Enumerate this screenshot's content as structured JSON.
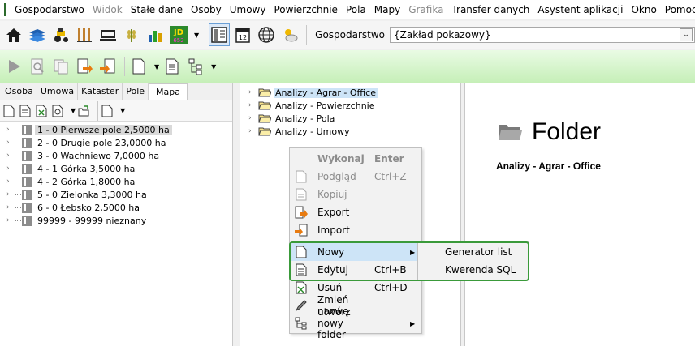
{
  "menubar": {
    "items": [
      {
        "label": "Gospodarstwo",
        "disabled": false
      },
      {
        "label": "Widok",
        "disabled": true
      },
      {
        "label": "Stałe dane",
        "disabled": false
      },
      {
        "label": "Osoby",
        "disabled": false
      },
      {
        "label": "Umowy",
        "disabled": false
      },
      {
        "label": "Powierzchnie",
        "disabled": false
      },
      {
        "label": "Pola",
        "disabled": false
      },
      {
        "label": "Mapy",
        "disabled": false
      },
      {
        "label": "Grafika",
        "disabled": true
      },
      {
        "label": "Transfer danych",
        "disabled": false
      },
      {
        "label": "Asystent aplikacji",
        "disabled": false
      },
      {
        "label": "Okno",
        "disabled": false
      },
      {
        "label": "Pomoc",
        "disabled": false
      }
    ]
  },
  "toolbar": {
    "gospodarstwo_label": "Gospodarstwo",
    "gospodarstwo_value": "{Zakład pokazowy}",
    "jd_text": "JD",
    "jd_sub": "652",
    "calendar_text": "12"
  },
  "left_panel": {
    "tabs": [
      "Osoba",
      "Umowa",
      "Kataster",
      "Pole",
      "Mapa"
    ],
    "active_tab": "Mapa",
    "fields": [
      "1 - 0 Pierwsze pole 2,5000 ha",
      "2 - 0 Drugie pole 23,0000 ha",
      "3 - 0 Wachniewo 7,0000 ha",
      "4 - 1 Górka 3,5000 ha",
      "4 - 2 Górka 1,8000 ha",
      "5 - 0 Zielonka 3,3000 ha",
      "6 - 0 Łebsko 2,5000 ha",
      "99999 - 99999 nieznany"
    ]
  },
  "tree": {
    "items": [
      "Analizy - Agrar - Office",
      "Analizy - Powierzchnie",
      "Analizy - Pola",
      "Analizy - Umowy"
    ]
  },
  "right_panel": {
    "title": "Folder",
    "subtitle": "Analizy - Agrar - Office"
  },
  "context_menu": {
    "items": [
      {
        "label": "Wykonaj",
        "shortcut": "Enter"
      },
      {
        "label": "Podgląd",
        "shortcut": "Ctrl+Z"
      },
      {
        "label": "Kopiuj",
        "shortcut": ""
      },
      {
        "label": "Export",
        "shortcut": ""
      },
      {
        "label": "Import",
        "shortcut": ""
      },
      {
        "label": "Nowy",
        "shortcut": ""
      },
      {
        "label": "Edytuj",
        "shortcut": "Ctrl+B"
      },
      {
        "label": "Usuń",
        "shortcut": "Ctrl+D"
      },
      {
        "label": "Zmień nazwę",
        "shortcut": ""
      },
      {
        "label": "utwórz nowy folder",
        "shortcut": ""
      }
    ]
  },
  "submenu": {
    "items": [
      "Generator list",
      "Kwerenda SQL"
    ]
  },
  "colors": {
    "highlight_border": "#3a9a3a",
    "selection": "#cde4f7",
    "toolbar2_gradient_top": "#e9fbe4",
    "toolbar2_gradient_bottom": "#c6efb8"
  }
}
